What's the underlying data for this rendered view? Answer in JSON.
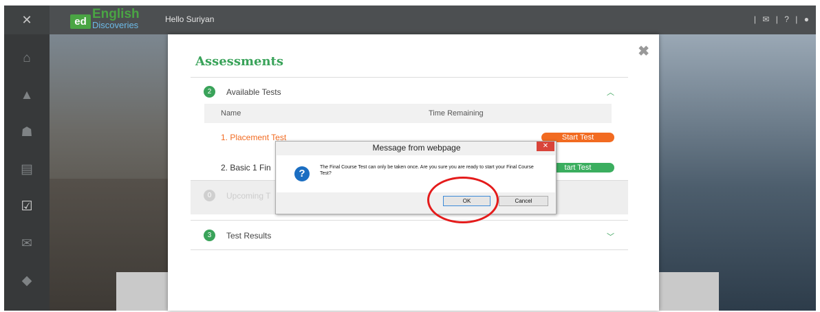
{
  "header": {
    "close_icon": "close-icon",
    "logo_badge": "ed",
    "logo_word1": "English",
    "logo_word2": "Discoveries",
    "greeting": "Hello Suriyan",
    "icons": [
      "mail-icon",
      "help-icon",
      "user-icon"
    ],
    "help_glyph": "?"
  },
  "sidebar": {
    "items": [
      {
        "icon": "home-icon"
      },
      {
        "icon": "graduation-cap-icon"
      },
      {
        "icon": "community-icon"
      },
      {
        "icon": "clipboard-icon"
      },
      {
        "icon": "assessment-icon",
        "active": true
      },
      {
        "icon": "inbox-icon"
      },
      {
        "icon": "book-icon"
      }
    ]
  },
  "modal": {
    "title": "Assessments",
    "close_glyph": "✖",
    "available": {
      "count": "2",
      "label": "Available Tests",
      "columns": [
        "Name",
        "Time Remaining"
      ],
      "tests": [
        {
          "name": "1. Placement Test",
          "button": "Start Test",
          "color": "#f26b21"
        },
        {
          "name": "2. Basic 1 Fin",
          "button": "tart Test",
          "color": "#3bae5f"
        }
      ]
    },
    "upcoming": {
      "count": "0",
      "label": "Upcoming T"
    },
    "results": {
      "count": "3",
      "label": "Test Results"
    }
  },
  "dialog": {
    "title": "Message from webpage",
    "icon": "question-icon",
    "icon_glyph": "?",
    "close_glyph": "✕",
    "text": "The Final Course Test can only be taken once. Are you sure you are ready to start  your Final Course Test?",
    "ok": "OK",
    "cancel": "Cancel"
  },
  "colors": {
    "accent_green": "#3aa35a",
    "orange": "#f26b21",
    "annotation_red": "#e41b1b"
  }
}
